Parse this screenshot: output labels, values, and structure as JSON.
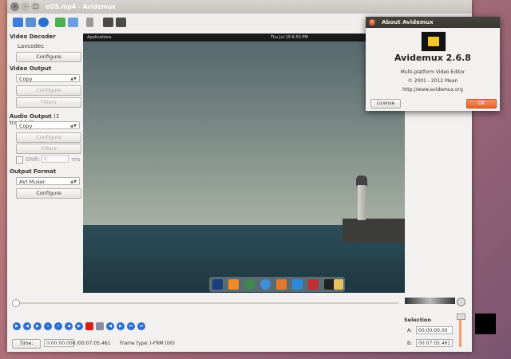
{
  "window": {
    "title": "eOS.mp4 - Avidemux"
  },
  "left": {
    "video_decoder": {
      "title": "Video Decoder",
      "value": "Lavcodec",
      "configure": "Configure"
    },
    "video_output": {
      "title": "Video Output",
      "codec": "Copy",
      "configure": "Configure",
      "filters": "Filters"
    },
    "audio_output": {
      "title": "Audio Output",
      "tracks": "(1 track(s))",
      "codec": "Copy",
      "configure": "Configure",
      "filters": "Filters",
      "shift_label": "Shift:",
      "shift_value": "0",
      "shift_unit": "ms"
    },
    "output_format": {
      "title": "Output Format",
      "muxer": "AVI Muxer",
      "configure": "Configure"
    }
  },
  "video_preview": {
    "topbar_left": "Applications",
    "topbar_center": "Thu Jul 19 6:50 PM"
  },
  "bottom": {
    "time_button": "Time:",
    "current_time": "0:00:00.000",
    "total_time": "/00:07:05.461",
    "frame_type": "Frame type: I-FRM (00)",
    "selection_title": "Selection",
    "a_label": "A:",
    "a_value": "00:00:00.00",
    "b_label": "B:",
    "b_value": "00:07:05.461"
  },
  "about": {
    "title": "About Avidemux",
    "name": "Avidemux 2.6.8",
    "subtitle": "Multi-platform Video Editor",
    "copyright": "© 2001 - 2012  Mean",
    "url": "http://www.avidemux.org",
    "license": "License",
    "ok": "OK"
  }
}
